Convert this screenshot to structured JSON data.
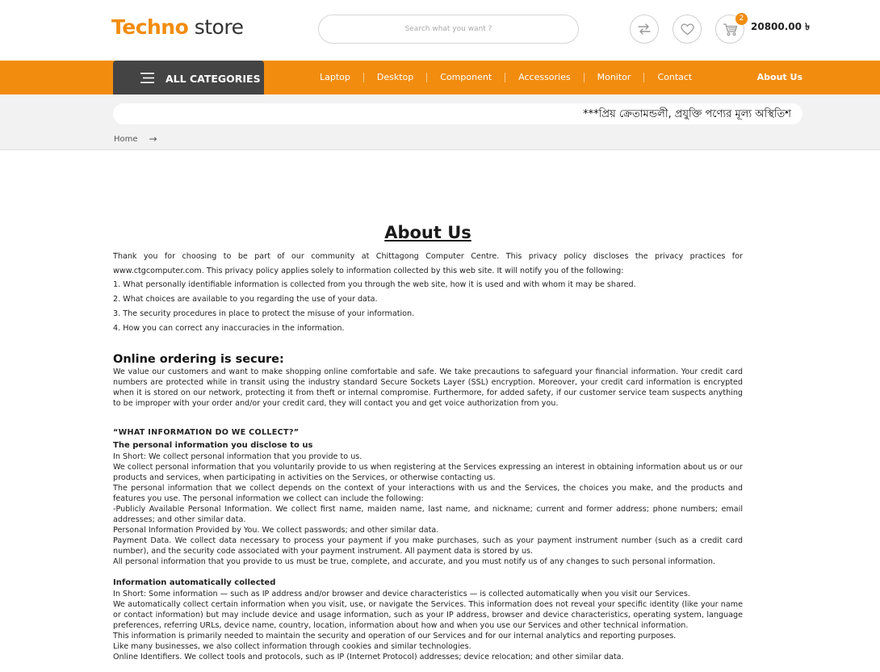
{
  "header": {
    "logo_part1": "Techno",
    "logo_part2": "store",
    "search_placeholder": "Search what you want ?",
    "cart_count": "2",
    "cart_total": "20800.00 ৳"
  },
  "nav": {
    "all_categories": "ALL CATEGORIES",
    "links": [
      "Laptop",
      "Desktop",
      "Component",
      "Accessories",
      "Monitor",
      "Contact"
    ],
    "about": "About Us"
  },
  "marquee": "***প্রিয় ক্রেতামন্ডলী, প্রযুক্তি পণ্যের মূল্য অস্থিতিশ",
  "breadcrumb": {
    "home": "Home",
    "separator": "→"
  },
  "page": {
    "title": "About Us",
    "intro": "Thank you for choosing to be part of our community at Chittagong Computer Centre. This privacy policy discloses the privacy practices for www.ctgcomputer.com. This privacy policy applies solely to information collected by this web site. It will notify you of the following:",
    "list": [
      "1. What personally identifiable information is collected from you through the web site, how it is used and with whom it may be shared.",
      "2. What choices are available to you regarding the use of your data.",
      "3. The security procedures in place to protect the misuse of your information.",
      "4. How you can correct any inaccuracies in the information."
    ],
    "secure_heading": "Online ordering is secure:",
    "secure_text": "We value our customers and want to make shopping online comfortable and safe. We take precautions to safeguard your financial information. Your credit card numbers are protected while in transit using the industry standard Secure Sockets Layer (SSL) encryption. Moreover, your credit card information is encrypted when it is stored on our network, protecting it from theft or internal compromise. Furthermore, for added safety, if our customer service team suspects anything to be improper with your order and/or your credit card, they will contact you and get voice authorization from you.",
    "collect_heading": "“WHAT INFORMATION DO WE COLLECT?”",
    "personal_heading": "The personal information you disclose to us",
    "personal_lines": [
      "In Short:  We collect personal information that you provide to us.",
      "We collect personal information that you voluntarily provide to us when registering at the Services expressing an interest in obtaining information about us or our products and services, when participating in activities on the Services, or otherwise contacting us.",
      "The personal information that we collect depends on the context of your interactions with us and the Services, the choices you make, and the products and features you use. The personal information we collect can include the following:",
      "-Publicly Available Personal Information. We collect first name, maiden name, last name, and nickname; current and former address; phone numbers; email addresses; and other similar data.",
      "Personal Information Provided by You. We collect passwords; and other similar data.",
      "Payment Data. We collect data necessary to process your payment if you make purchases, such as your payment instrument number (such as a credit card number), and the security code associated with your payment instrument. All payment data is stored by us.",
      "All personal information that you provide to us must be true, complete, and accurate, and you must notify us of any changes to such personal information."
    ],
    "auto_heading": "Information automatically collected",
    "auto_lines": [
      "In Short:   Some information — such as IP address and/or browser and device characteristics — is collected automatically when you visit our Services.",
      " We automatically collect certain information when you visit, use, or navigate the Services. This information does not reveal your specific identity (like your name or contact information) but may include device and usage information, such as your IP address, browser and device characteristics, operating system, language preferences, referring URLs, device name, country, location, information about how and when you use our Services and other technical information.",
      "This information is primarily needed to maintain the security and operation of our Services and for our internal analytics and reporting purposes.",
      " Like many businesses, we also collect information through cookies and similar technologies.",
      "Online Identifiers. We collect tools and protocols, such as IP (Internet Protocol) addresses; device relocation; and other similar data."
    ]
  },
  "colors": {
    "accent": "#f28c0f",
    "dark": "#444444",
    "band": "#f2f2f2"
  },
  "icons": [
    "menu-icon",
    "compare-icon",
    "heart-icon",
    "cart-icon",
    "arrow-right-icon"
  ]
}
